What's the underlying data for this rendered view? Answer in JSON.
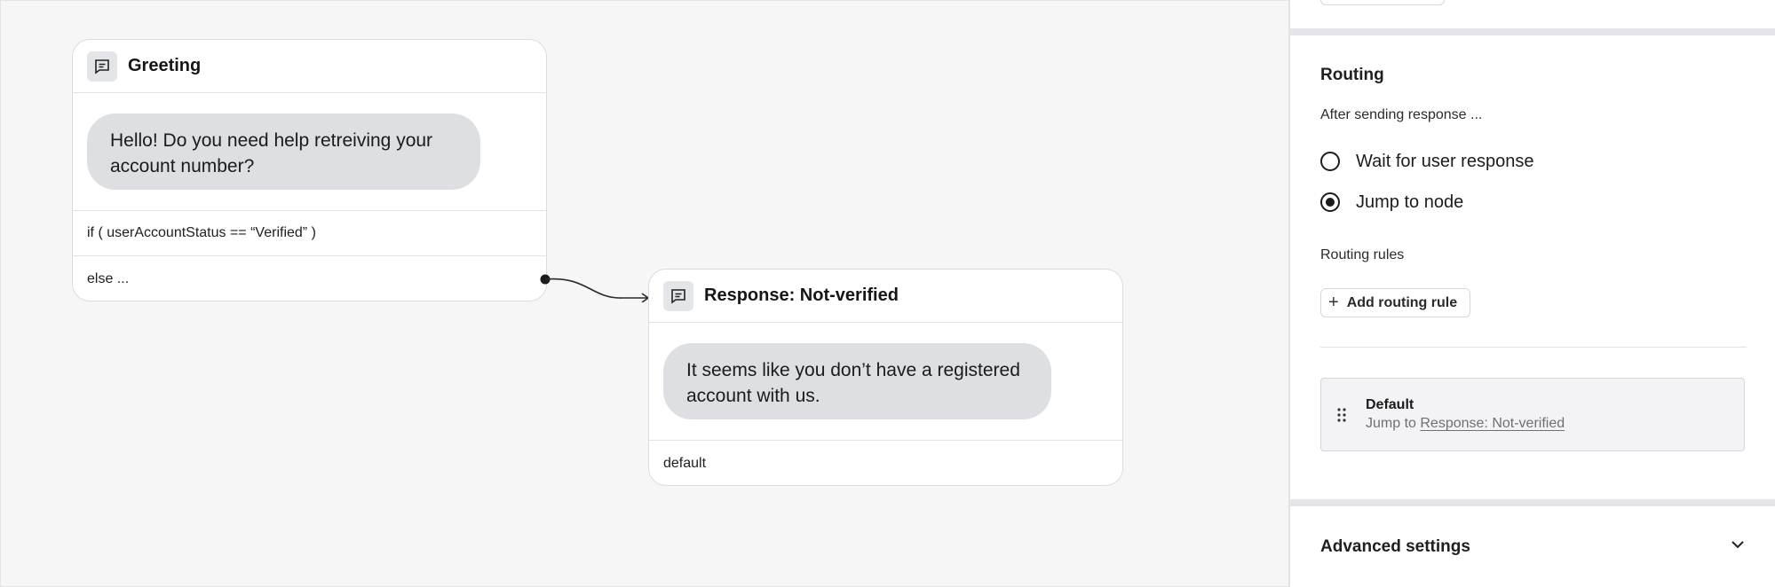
{
  "canvas": {
    "greeting_node": {
      "title": "Greeting",
      "icon": "message-icon",
      "message": "Hello!  Do you need help retreiving your account number?",
      "conditions": [
        "if ( userAccountStatus == “Verified” )",
        "else ..."
      ]
    },
    "response_node": {
      "title": "Response: Not-verified",
      "icon": "message-icon",
      "message": "It seems like you don’t have a registered account with us.",
      "conditions": [
        "default"
      ]
    }
  },
  "panel": {
    "routing": {
      "title": "Routing",
      "subtitle": "After sending response ...",
      "options": [
        {
          "label": "Wait for user response",
          "selected": false
        },
        {
          "label": "Jump to node",
          "selected": true
        }
      ],
      "rules_label": "Routing rules",
      "add_rule_label": "Add routing rule",
      "rule": {
        "title": "Default",
        "prefix": "Jump to",
        "target": "Response: Not-verified"
      }
    },
    "advanced": {
      "title": "Advanced settings",
      "icon": "chevron-down-icon"
    }
  },
  "colors": {
    "canvas_bg": "#f6f6f7",
    "bubble_bg": "#dedfe2",
    "divider": "#e4e5e8",
    "text": "#161616"
  }
}
